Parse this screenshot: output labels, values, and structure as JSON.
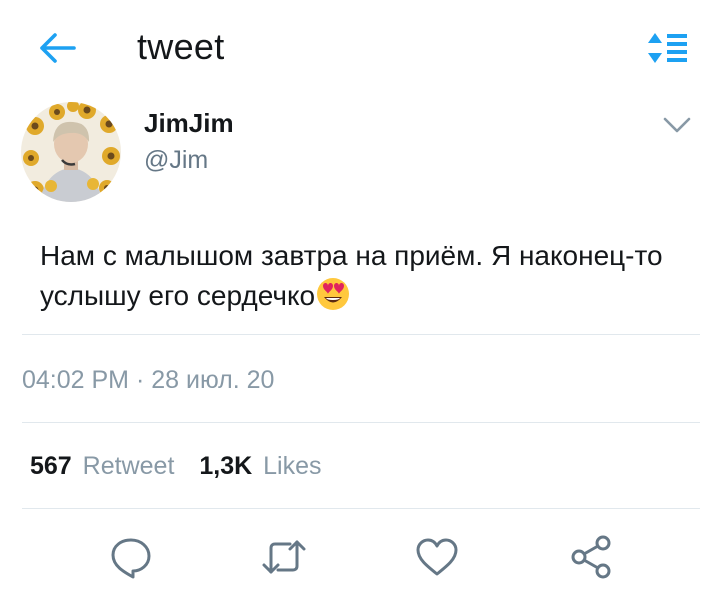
{
  "header": {
    "title": "tweet",
    "back_icon": "arrow-left-icon",
    "sort_icon": "sort-list-icon",
    "accent_color": "#1da1f2"
  },
  "tweet": {
    "author": {
      "display_name": "JimJim",
      "handle": "@Jim",
      "avatar": "avatar-photo-sunflowers"
    },
    "text": "Нам с малышом завтра на приём. Я наконец-то услышу его сердечко",
    "emoji": "smiling-face-with-heart-eyes",
    "timestamp": "04:02 PM · 28 июл. 20"
  },
  "stats": {
    "retweet_count": "567",
    "retweet_label": "Retweet",
    "likes_count": "1,3K",
    "likes_label": "Likes"
  },
  "actions": [
    "reply-icon",
    "retweet-icon",
    "like-icon",
    "share-icon"
  ],
  "colors": {
    "text": "#14171a",
    "secondary": "#657786",
    "divider": "#e1e8ed"
  }
}
